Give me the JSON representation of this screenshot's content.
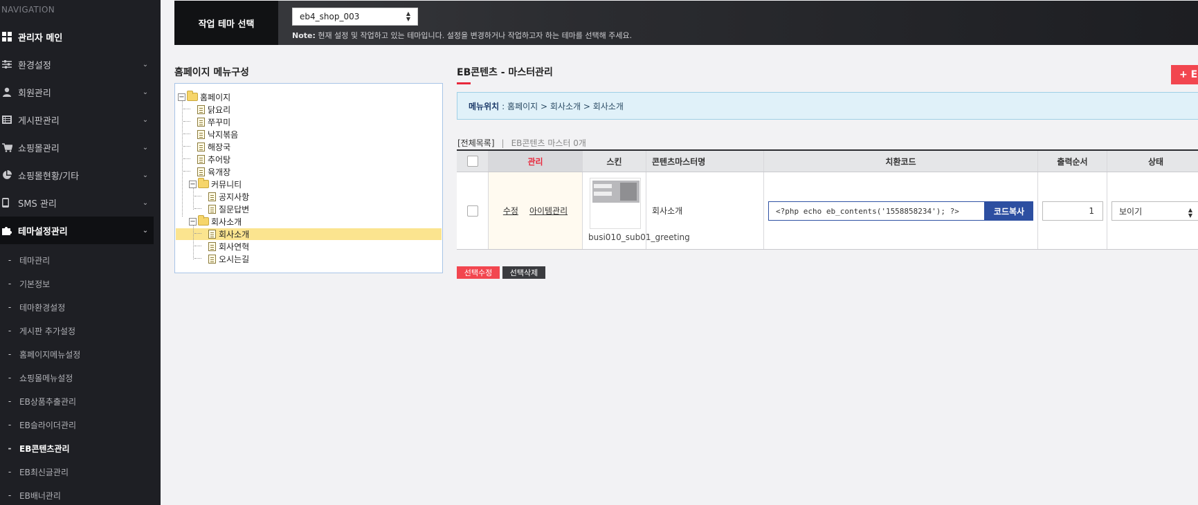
{
  "sidebar": {
    "nav_title": "NAVIGATION",
    "main_item": "관리자 메인",
    "items": [
      {
        "label": "환경설정",
        "icon": "sliders-icon"
      },
      {
        "label": "회원관리",
        "icon": "user-icon"
      },
      {
        "label": "게시판관리",
        "icon": "list-icon"
      },
      {
        "label": "쇼핑몰관리",
        "icon": "cart-icon"
      },
      {
        "label": "쇼핑몰현황/기타",
        "icon": "pie-chart-icon"
      },
      {
        "label": "SMS 관리",
        "icon": "mobile-icon"
      },
      {
        "label": "테마설정관리",
        "icon": "puzzle-icon"
      }
    ],
    "sub_items": [
      "테마관리",
      "기본정보",
      "테마환경설정",
      "게시판 추가설정",
      "홈페이지메뉴설정",
      "쇼핑몰메뉴설정",
      "EB상품추출관리",
      "EB슬라이더관리",
      "EB콘텐츠관리",
      "EB최신글관리",
      "EB배너관리"
    ],
    "current_sub": "EB콘텐츠관리"
  },
  "topbar": {
    "label": "작업 테마 선택",
    "selected_theme": "eb4_shop_003",
    "note_bold": "Note:",
    "note_text": " 현재 설정 및 작업하고 있는 테마입니다. 설정을 변경하거나 작업하고자 하는 테마를 선택해 주세요."
  },
  "tree": {
    "title": "홈페이지 메뉴구성",
    "root": "홈페이지",
    "nodes": [
      "닭요리",
      "쭈꾸미",
      "낙지볶음",
      "해장국",
      "추어탕",
      "육개장"
    ],
    "community": "커뮤니티",
    "community_children": [
      "공지사항",
      "질문답변"
    ],
    "company": "회사소개",
    "company_children": [
      "회사소개",
      "회사연혁",
      "오시는길"
    ]
  },
  "main": {
    "title": "EB콘텐츠 - 마스터관리",
    "add_button": "+ E",
    "location_label": "메뉴위치",
    "location_path": ": 홈페이지 > 회사소개 > 회사소개",
    "tab_all": "[전체목록]",
    "tab_count": "EB콘텐츠 마스터 0개",
    "columns": [
      "관리",
      "스킨",
      "콘텐츠마스터명",
      "치환코드",
      "출력순서",
      "상태"
    ],
    "row": {
      "edit_link": "수정",
      "item_link": "아이템관리",
      "skin": "busi010_sub01_greeting",
      "name": "회사소개",
      "code": "<?php echo eb_contents('1558858234'); ?>",
      "copy_button": "코드복사",
      "order": "1",
      "status": "보이기"
    },
    "btn_edit_selected": "선택수정",
    "btn_delete_selected": "선택삭제"
  },
  "colors": {
    "accent_red": "#e8283c",
    "code_blue": "#2d4fa1",
    "sidebar_bg": "#1e1f24"
  }
}
